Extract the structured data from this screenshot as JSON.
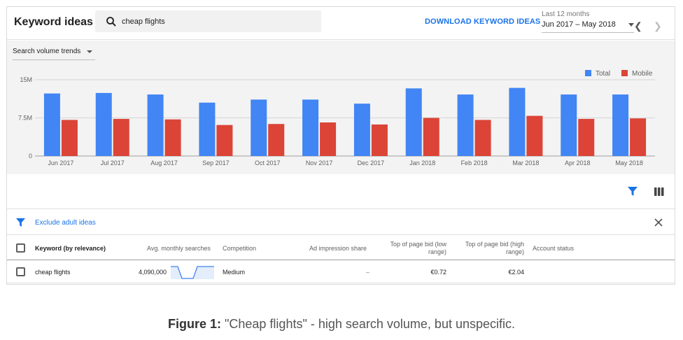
{
  "header": {
    "title": "Keyword ideas",
    "search_value": "cheap flights",
    "download_label": "DOWNLOAD KEYWORD IDEAS",
    "date_label": "Last 12 months",
    "date_value": "Jun 2017 – May 2018"
  },
  "chart_controls": {
    "trend_select": "Search volume trends"
  },
  "chart_data": {
    "type": "bar",
    "categories": [
      "Jun 2017",
      "Jul 2017",
      "Aug 2017",
      "Sep 2017",
      "Oct 2017",
      "Nov 2017",
      "Dec 2017",
      "Jan 2018",
      "Feb 2018",
      "Mar 2018",
      "Apr 2018",
      "May 2018"
    ],
    "series": [
      {
        "name": "Total",
        "color": "#4285f4",
        "values": [
          12.3,
          12.4,
          12.1,
          10.5,
          11.1,
          11.1,
          10.3,
          13.3,
          12.1,
          13.4,
          12.1,
          12.1
        ]
      },
      {
        "name": "Mobile",
        "color": "#db4437",
        "values": [
          7.1,
          7.3,
          7.2,
          6.1,
          6.3,
          6.6,
          6.2,
          7.5,
          7.1,
          7.9,
          7.3,
          7.4
        ]
      }
    ],
    "y_ticks": [
      "15M",
      "7.5M",
      "0"
    ],
    "ylim": [
      0,
      15
    ],
    "grid": true,
    "legend_position": "top-right"
  },
  "filter": {
    "label": "Exclude adult ideas"
  },
  "table": {
    "columns": {
      "keyword": "Keyword (by relevance)",
      "searches": "Avg. monthly searches",
      "competition": "Competition",
      "impression": "Ad impression share",
      "bid_low": "Top of page bid (low range)",
      "bid_high": "Top of page bid (high range)",
      "status": "Account status"
    },
    "rows": [
      {
        "keyword": "cheap flights",
        "searches": "4,090,000",
        "competition": "Medium",
        "impression": "–",
        "bid_low": "€0.72",
        "bid_high": "€2.04",
        "status": ""
      }
    ]
  },
  "caption": {
    "label": "Figure 1:",
    "text": " \"Cheap flights\" - high search volume, but unspecific."
  }
}
